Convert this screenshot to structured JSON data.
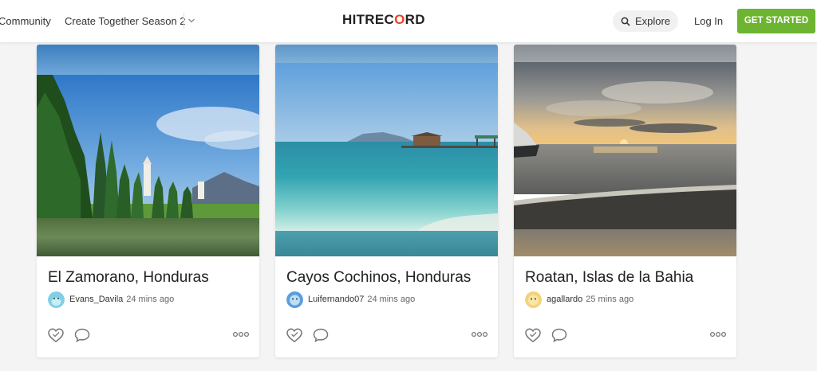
{
  "header": {
    "nav": {
      "community": "Community",
      "season": "Create Together Season 2"
    },
    "logo": {
      "hit": "HIT",
      "rec_r": "REC",
      "rec_o": "O",
      "rec_rd": "RD"
    },
    "explore": "Explore",
    "login": "Log In",
    "cta": "GET STARTED"
  },
  "colors": {
    "accent": "#6db431",
    "logo_o": "#e8442c"
  },
  "cards": [
    {
      "title": "El Zamorano, Honduras",
      "author": "Evans_Davila",
      "time": "24 mins ago"
    },
    {
      "title": "Cayos Cochinos, Honduras",
      "author": "Luifernando07",
      "time": "24 mins ago"
    },
    {
      "title": "Roatan, Islas de la Bahia",
      "author": "agallardo",
      "time": "25 mins ago"
    }
  ]
}
